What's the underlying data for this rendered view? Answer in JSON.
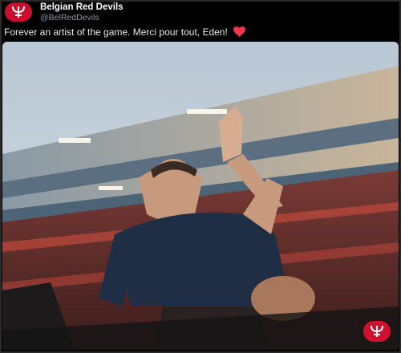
{
  "tweet": {
    "account_name": "Belgian Red Devils",
    "handle": "@BelRedDevils",
    "text": "Forever an artist of the game. Merci pour tout, Eden!",
    "emoji": "red-heart-icon"
  },
  "media": {
    "subject": "player-waving-photo",
    "badge_icon": "trident-logo-icon"
  },
  "colors": {
    "brand_red": "#c8102e",
    "heart_red": "#f0364a",
    "text": "#e7e9ea",
    "muted": "#8b98a5"
  }
}
